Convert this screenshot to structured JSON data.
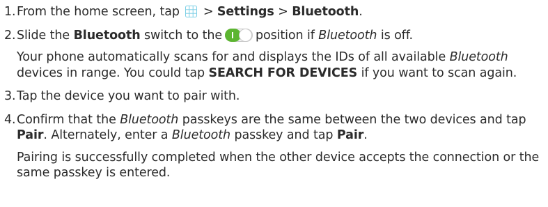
{
  "steps": [
    {
      "number": "1.",
      "parts": {
        "a": "From the home screen, tap",
        "b": ">",
        "c": "Settings",
        "d": ">",
        "e": "Bluetooth",
        "f": "."
      },
      "icon": "apps-grid-icon"
    },
    {
      "number": "2.",
      "parts": {
        "a": "Slide the",
        "b": "Bluetooth",
        "c": "switch to the",
        "d": "position if",
        "e": "Bluetooth",
        "f": "is off."
      },
      "icon": "toggle-on-icon",
      "note": {
        "a": "Your phone automatically scans for and displays the IDs of all available",
        "b": "Bluetooth",
        "c": "devices in range. You could tap",
        "d": "SEARCH FOR DEVICES",
        "e": "if you want to scan again."
      }
    },
    {
      "number": "3.",
      "text": "Tap the device you want to pair with."
    },
    {
      "number": "4.",
      "parts": {
        "a": "Confirm that the",
        "b": "Bluetooth",
        "c": "passkeys are the same between the two devices and tap",
        "d": "Pair",
        "e": ". Alternately, enter a",
        "f": "Bluetooth",
        "g": "passkey and tap",
        "h": "Pair",
        "i": "."
      },
      "note": "Pairing is successfully completed when the other device accepts the connection or the same passkey is entered."
    }
  ],
  "colors": {
    "text": "#2b2b2b",
    "toggle_on": "#5cb531",
    "icon_grid": "#7fd0e6"
  }
}
